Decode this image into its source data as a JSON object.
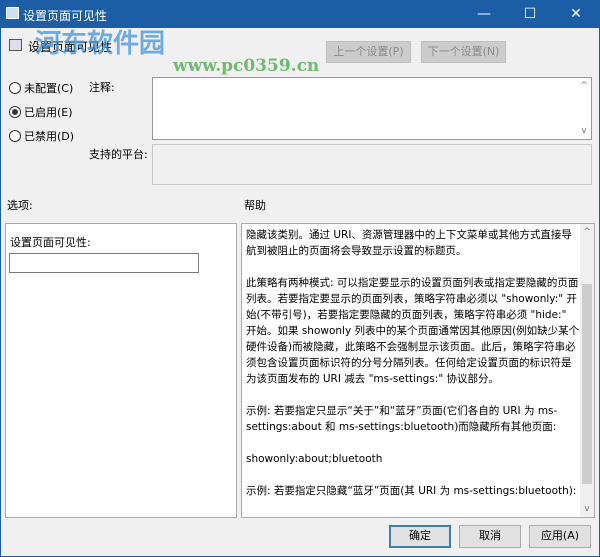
{
  "window": {
    "title": "设置页面可见性",
    "minimize": "—",
    "maximize": "☐",
    "close": "✕"
  },
  "header": {
    "policy_name": "设置页面可见性",
    "prev_button": "上一个设置(P)",
    "next_button": "下一个设置(N)"
  },
  "watermark": {
    "name": "河东软件园",
    "url": "www.pc0359.cn"
  },
  "state": {
    "options": [
      {
        "label": "未配置(C)",
        "checked": false
      },
      {
        "label": "已启用(E)",
        "checked": true
      },
      {
        "label": "已禁用(D)",
        "checked": false
      }
    ]
  },
  "comment": {
    "label": "注释:",
    "value": ""
  },
  "platform": {
    "label": "支持的平台:",
    "value": ""
  },
  "options_label": "选项:",
  "help_label": "帮助",
  "options_panel": {
    "field_label": "设置页面可见性:",
    "field_value": ""
  },
  "help_text": "隐藏该类别。通过 URI、资源管理器中的上下文菜单或其他方式直接导航到被阻止的页面将会导致显示设置的标题页。\n\n此策略有两种模式: 可以指定要显示的设置页面列表或指定要隐藏的页面列表。若要指定要显示的页面列表，策略字符串必须以 \"showonly:\" 开始(不带引号)，若要指定要隐藏的页面列表，策略字符串必须 \"hide:\" 开始。如果 showonly 列表中的某个页面通常因其他原因(例如缺少某个硬件设备)而被隐藏，此策略不会强制显示该页面。此后，策略字符串必须包含设置页面标识符的分号分隔列表。任何给定设置页面的标识符是为该页面发布的 URI 减去 \"ms-settings:\" 协议部分。\n\n示例: 若要指定只显示“关于”和“蓝牙”页面(它们各自的 URI 为 ms-settings:about 和 ms-settings:bluetooth)而隐藏所有其他页面:\n\nshowonly:about;bluetooth\n\n示例: 若要指定只隐藏“蓝牙”页面(其 URI 为 ms-settings:bluetooth):\n\nhide:bluetooth",
  "footer": {
    "ok": "确定",
    "cancel": "取消",
    "apply": "应用(A)"
  }
}
